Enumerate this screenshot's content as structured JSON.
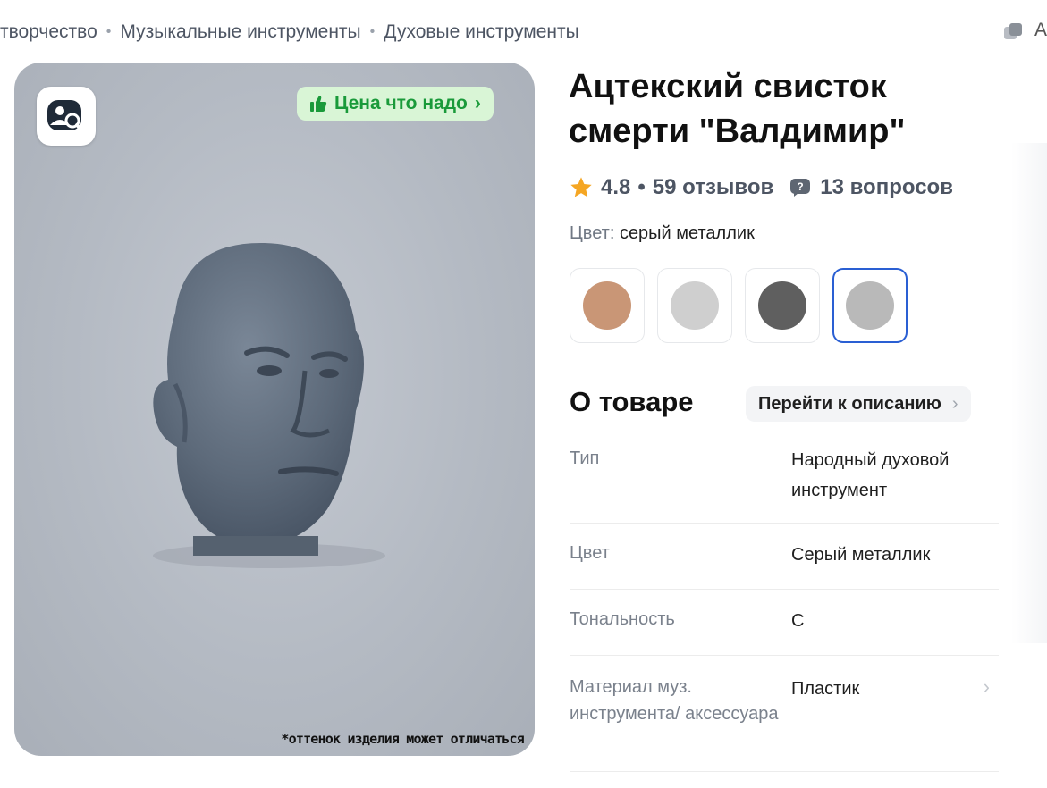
{
  "breadcrumb": {
    "items": [
      "творчество",
      "Музыкальные инструменты",
      "Духовые инструменты"
    ],
    "separator": "•"
  },
  "top_right": {
    "partial_text": "А",
    "icon": "compare-icon"
  },
  "image_card": {
    "search_by_photo_icon": "search-by-photo-icon",
    "price_badge": {
      "label": "Цена что надо",
      "icon": "thumbs-up-icon"
    },
    "disclaimer": "*оттенок изделия может отличаться"
  },
  "product": {
    "title": "Ацтекский свисток смерти \"Валдимир\"",
    "rating": "4.8",
    "reviews": "59 отзывов",
    "questions": "13 вопросов",
    "color_label": "Цвет:",
    "color_value": "серый металлик",
    "swatches": [
      {
        "name": "beige",
        "color": "#c99676"
      },
      {
        "name": "light-gray",
        "color": "#cfcfcf"
      },
      {
        "name": "dark-gray",
        "color": "#5f5f5f"
      },
      {
        "name": "metallic-gray",
        "color": "#b9b9b9",
        "selected": true
      }
    ]
  },
  "about": {
    "title": "О товаре",
    "goto_label": "Перейти к описанию",
    "specs": [
      {
        "key": "Тип",
        "value": "Народный духовой инструмент"
      },
      {
        "key": "Цвет",
        "value": "Серый металлик"
      },
      {
        "key": "Тональность",
        "value": "С"
      },
      {
        "key": "Материал муз. инструмента/ аксессуара",
        "value": "Пластик"
      }
    ]
  },
  "colors": {
    "accent_blue": "#2a5fd3",
    "badge_green_bg": "#d9f5d6",
    "badge_green_text": "#1a9a3a",
    "star": "#f5a623"
  }
}
